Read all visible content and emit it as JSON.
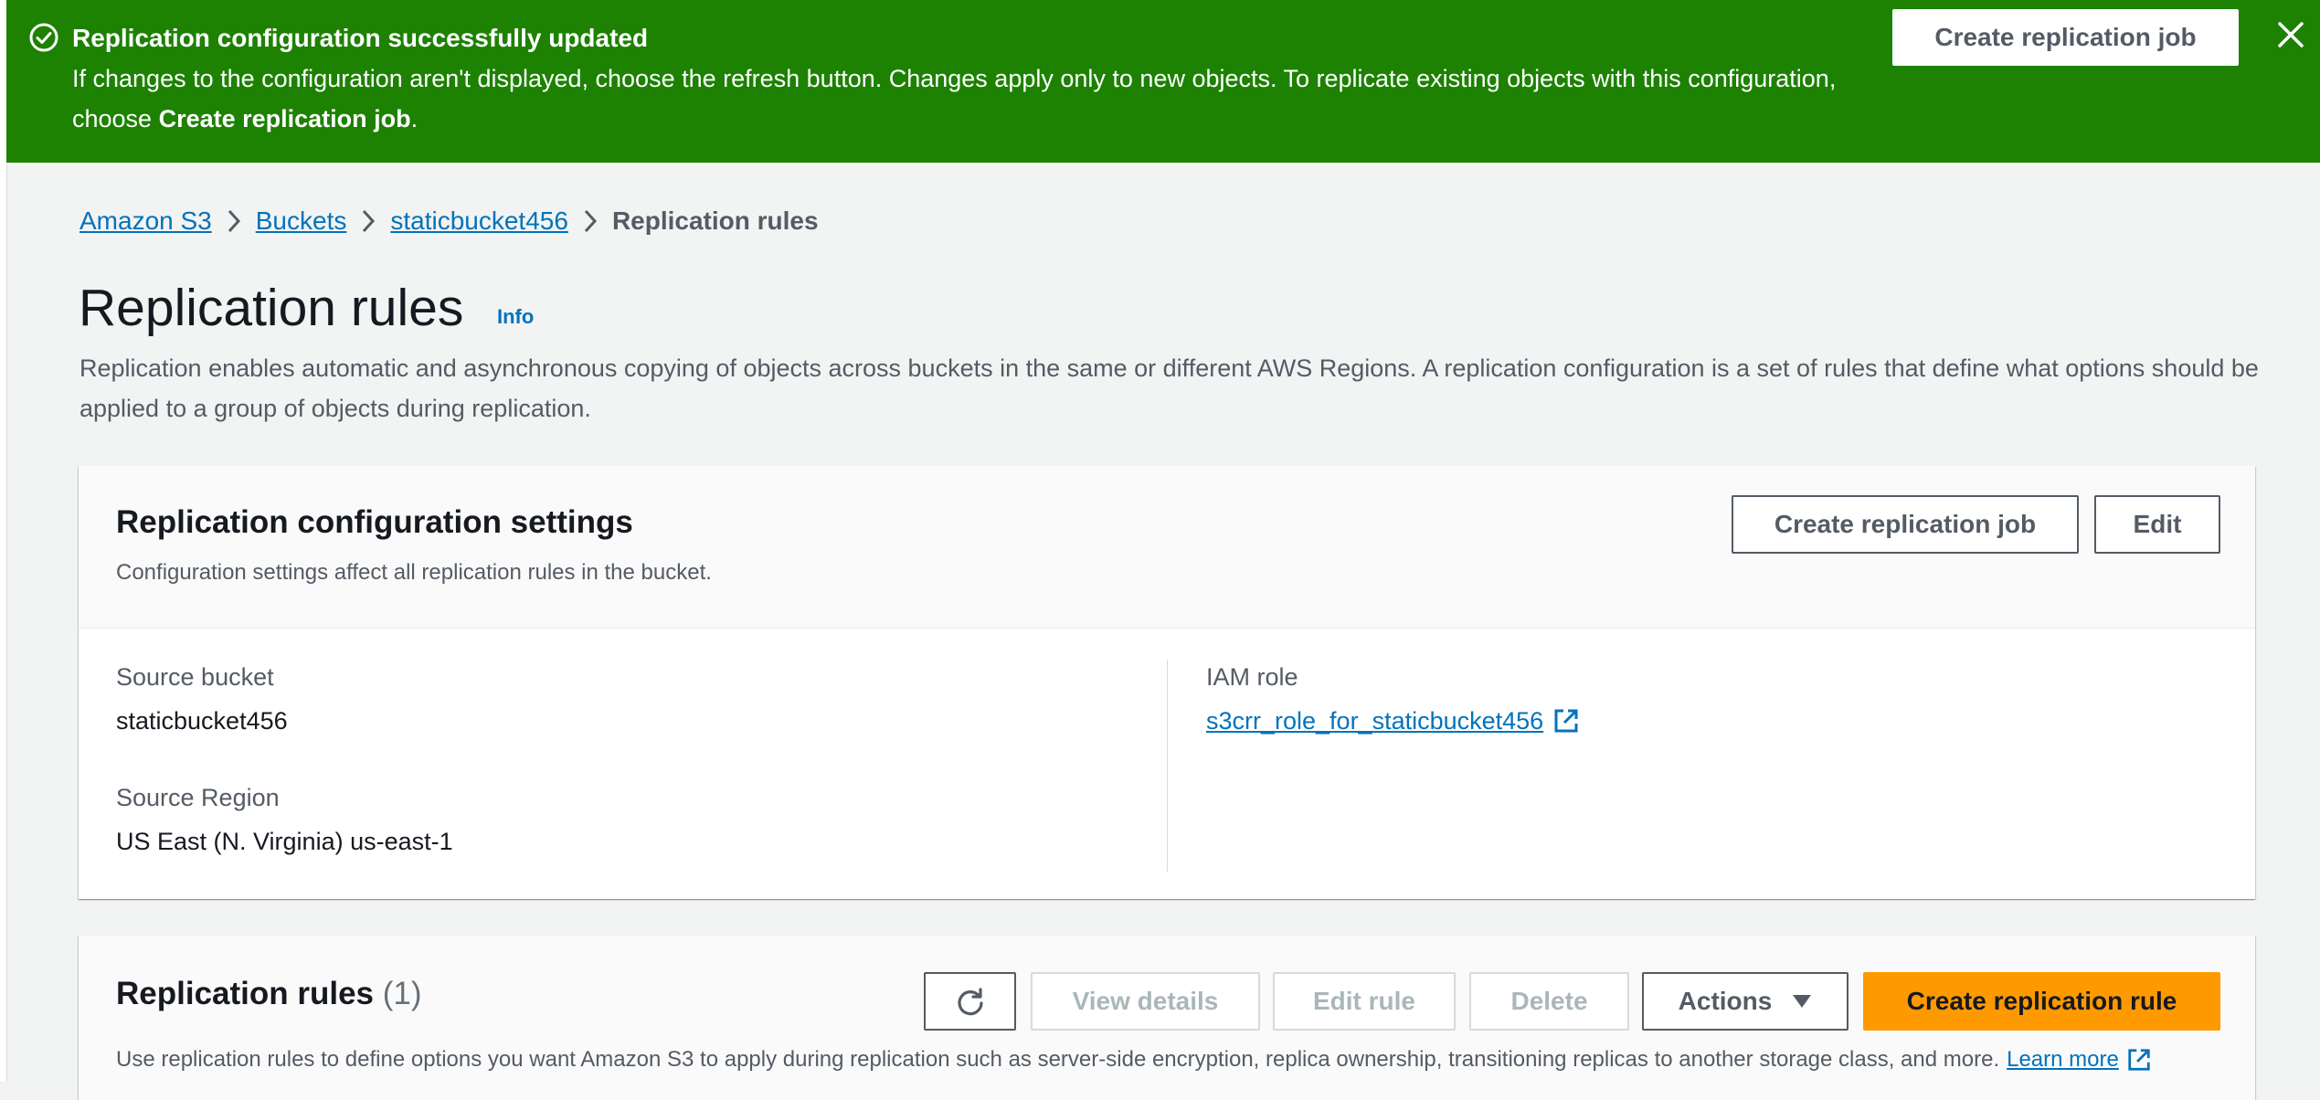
{
  "flash": {
    "title": "Replication configuration successfully updated",
    "body_prefix": "If changes to the configuration aren't displayed, choose the refresh button. Changes apply only to new objects. To replicate existing objects with this configuration, choose ",
    "body_bold": "Create replication job",
    "body_suffix": ".",
    "action_label": "Create replication job",
    "icon": "success-check-icon",
    "color": "#1d8102"
  },
  "breadcrumb": {
    "items": [
      "Amazon S3",
      "Buckets",
      "staticbucket456"
    ],
    "current": "Replication rules"
  },
  "page": {
    "title": "Replication rules",
    "info": "Info",
    "description": "Replication enables automatic and asynchronous copying of objects across buckets in the same or different AWS Regions. A replication configuration is a set of rules that define what options should be applied to a group of objects during replication."
  },
  "settings": {
    "title": "Replication configuration settings",
    "description": "Configuration settings affect all replication rules in the bucket.",
    "create_job_label": "Create replication job",
    "edit_label": "Edit",
    "source_bucket_label": "Source bucket",
    "source_bucket_value": "staticbucket456",
    "source_region_label": "Source Region",
    "source_region_value": "US East (N. Virginia) us-east-1",
    "iam_role_label": "IAM role",
    "iam_role_value": "s3crr_role_for_staticbucket456"
  },
  "rules": {
    "title": "Replication rules",
    "count": "(1)",
    "view_details_label": "View details",
    "edit_rule_label": "Edit rule",
    "delete_label": "Delete",
    "actions_label": "Actions",
    "create_rule_label": "Create replication rule",
    "description": "Use replication rules to define options you want Amazon S3 to apply during replication such as server-side encryption, replica ownership, transitioning replicas to another storage class, and more.",
    "learn_more": "Learn more"
  },
  "colors": {
    "link": "#0073bb",
    "primary": "#ff9900",
    "success": "#1d8102"
  }
}
